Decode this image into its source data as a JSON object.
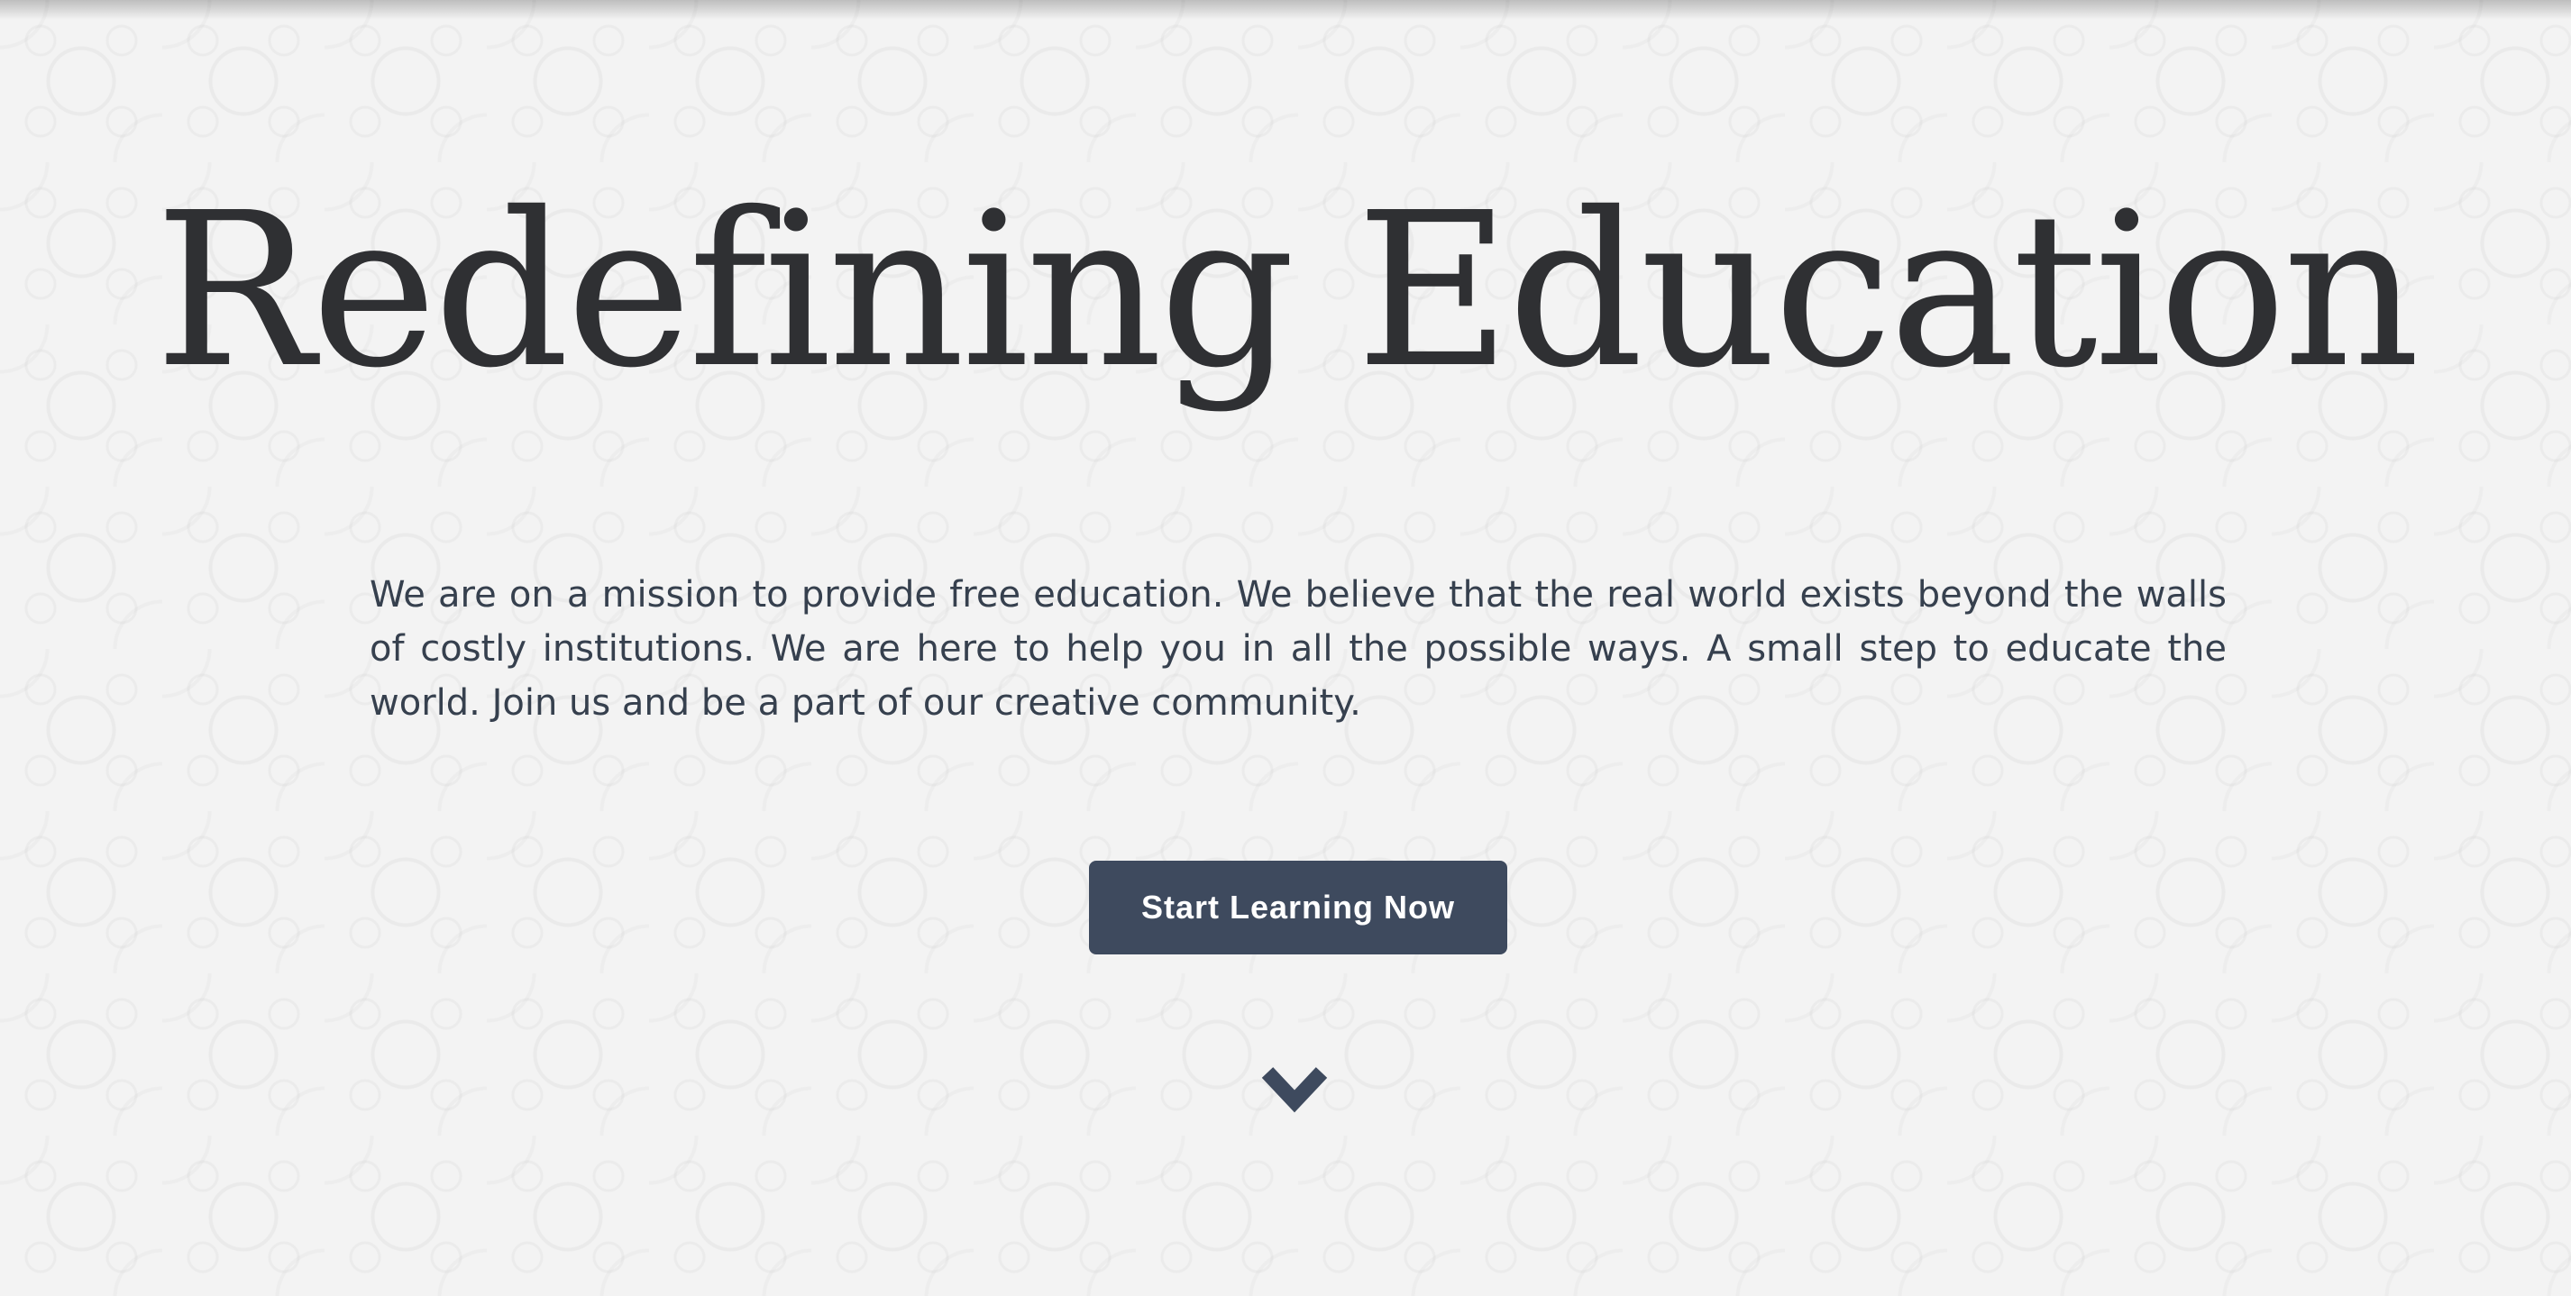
{
  "hero": {
    "title": "Redefining Education",
    "description": "We are on a mission to provide free education. We believe that the real world exists beyond the walls of costly institutions. We are here to help you in all the possible ways. A small step to educate the world. Join us and be a part of our creative community.",
    "cta_label": "Start Learning Now",
    "scroll_icon": "chevron-down-icon"
  },
  "colors": {
    "background": "#f3f3f3",
    "title": "#2f3033",
    "text": "#36404e",
    "button": "#3e4a5e",
    "button_text": "#ffffff",
    "chevron": "#3e4a5e"
  }
}
